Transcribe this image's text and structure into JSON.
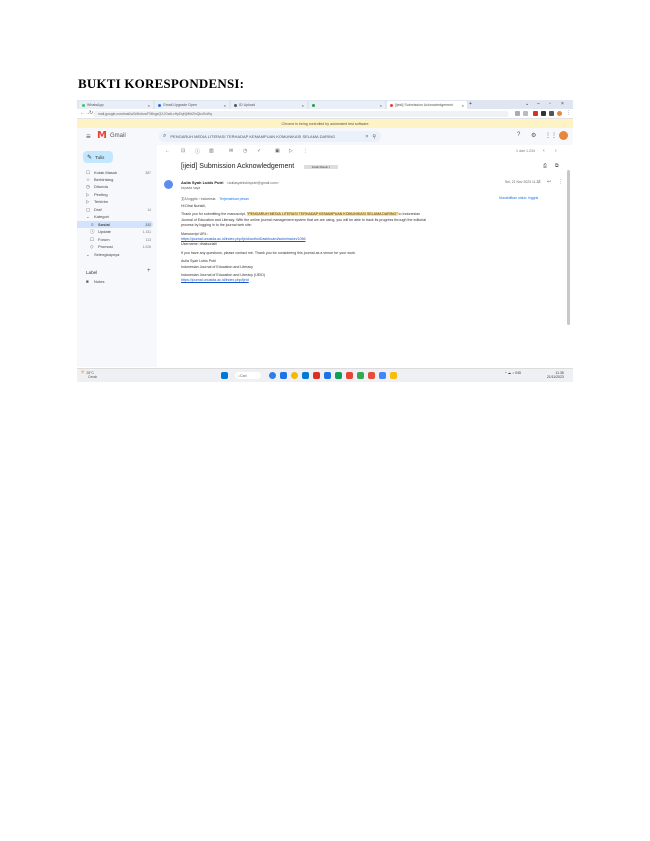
{
  "document": {
    "heading": "BUKTI KORESPONDENSI:"
  },
  "browser": {
    "tabs": [
      {
        "label": "WhatsApp",
        "color": "#25d366"
      },
      {
        "label": "Gmail Upgrade Open",
        "color": "#1a73e8"
      },
      {
        "label": "ID Upload",
        "color": "#555555"
      },
      {
        "label": "",
        "color": "#16a34a"
      },
      {
        "label": "[ijeid] Submission Acknowledgement",
        "color": "#ea4335",
        "active": true
      }
    ],
    "address": "mail.google.com/mail/u/0/#inbox/FMfcgzQXJGwtLvHpDqKjMbtZlnQkxSvWq",
    "banner": "Chrome is being controlled by automated test software"
  },
  "gmail": {
    "app_name": "Gmail",
    "search_query": "PENGARUH MEDIA LITERASI TERHADAP KEMAMPUAN KOMUNIKASI SELAMA DARING",
    "compose_label": "Tulis",
    "sidebar": [
      {
        "icon": "inbox-icon",
        "glyph": "☐",
        "label": "Kotak Masuk",
        "count": "387",
        "active": false
      },
      {
        "icon": "star-icon",
        "glyph": "☆",
        "label": "Berbintang",
        "count": "",
        "active": false
      },
      {
        "icon": "clock-icon",
        "glyph": "◷",
        "label": "Ditunda",
        "count": "",
        "active": false
      },
      {
        "icon": "important-icon",
        "glyph": "▷",
        "label": "Penting",
        "count": "",
        "active": false
      },
      {
        "icon": "send-icon",
        "glyph": "▷",
        "label": "Terkirim",
        "count": "",
        "active": false
      },
      {
        "icon": "draft-icon",
        "glyph": "▢",
        "label": "Draf",
        "count": "14",
        "active": false
      },
      {
        "icon": "category-icon",
        "glyph": "⌄",
        "label": "Kategori",
        "count": "",
        "active": false
      },
      {
        "icon": "social-icon",
        "glyph": "☺",
        "label": "Sosial",
        "count": "232",
        "active": true,
        "sub": true
      },
      {
        "icon": "updates-icon",
        "glyph": "ⓘ",
        "label": "Update",
        "count": "1.311",
        "active": false,
        "sub": true
      },
      {
        "icon": "forum-icon",
        "glyph": "☐",
        "label": "Forum",
        "count": "113",
        "active": false,
        "sub": true
      },
      {
        "icon": "promo-icon",
        "glyph": "◇",
        "label": "Promosi",
        "count": "1.026",
        "active": false,
        "sub": true
      },
      {
        "icon": "more-icon",
        "glyph": "⌄",
        "label": "Selengkapnya",
        "count": "",
        "active": false
      }
    ],
    "labels_heading": "Label",
    "labels": [
      {
        "label": "Notes"
      }
    ],
    "pager": "1 dari 1.234",
    "email": {
      "subject": "[ijeid] Submission Acknowledgement",
      "label_chip": "Kotak Masuk ×",
      "sender_name": "Aulia Syah Lubis Putri",
      "sender_email": "<auliasyahlubisputri@gmail.com>",
      "recipient": "kepada saya",
      "date": "Sel, 21 Nov 2023 11.32",
      "translate_prefix": "Inggris",
      "translate_target": "Indonesia",
      "translate_link": "Terjemahkan pesan",
      "turn_off": "Nonaktifkan untuk: Inggris",
      "greeting": "Hi Dhai Nurlaili,",
      "para1_start": "Thank you for submitting the manuscript, ",
      "para1_highlight": "\"PENGARUH MEDIA LITERASI TERHADAP KEMAMPUAN KOMUNIKASI SELAMA DARING\"",
      "para1_end": " to Indonesian Journal of Education and Literacy. With the online journal management system that we are using, you will be able to track its progress through the editorial process by logging in to the journal web site:",
      "url_label": "Manuscript URL:",
      "url": "https://journal.unusida.ac.id/index.php/ijeid/authorDashboard/submission/1056",
      "username": "Username: dhainurlaili",
      "para2": "If you have any questions, please contact me. Thank you for considering this journal as a venue for your work.",
      "sign1": "Aulia Syah Lubis Putri",
      "sign2": "Indonesian Journal of Education and Literacy",
      "footer1": "Indonesian Journal of Education and Literacy (IJEID)",
      "footer_url": "https://journal.unusida.ac.id/index.php/ijeid"
    }
  },
  "taskbar": {
    "weather_temp": "28°C",
    "weather_desc": "Cerah",
    "search_label": "Cari",
    "apps": [
      "#2b7de9",
      "#1a73e8",
      "#f5b800",
      "#0078d4",
      "#d93025",
      "#1a73e8",
      "#0f9d58",
      "#ea4335",
      "#34a853",
      "#e84c3d",
      "#4285f4",
      "#fbbc05"
    ],
    "tray": "^  ☁  ♪  IND",
    "time": "11.35",
    "date": "21/11/2023"
  }
}
